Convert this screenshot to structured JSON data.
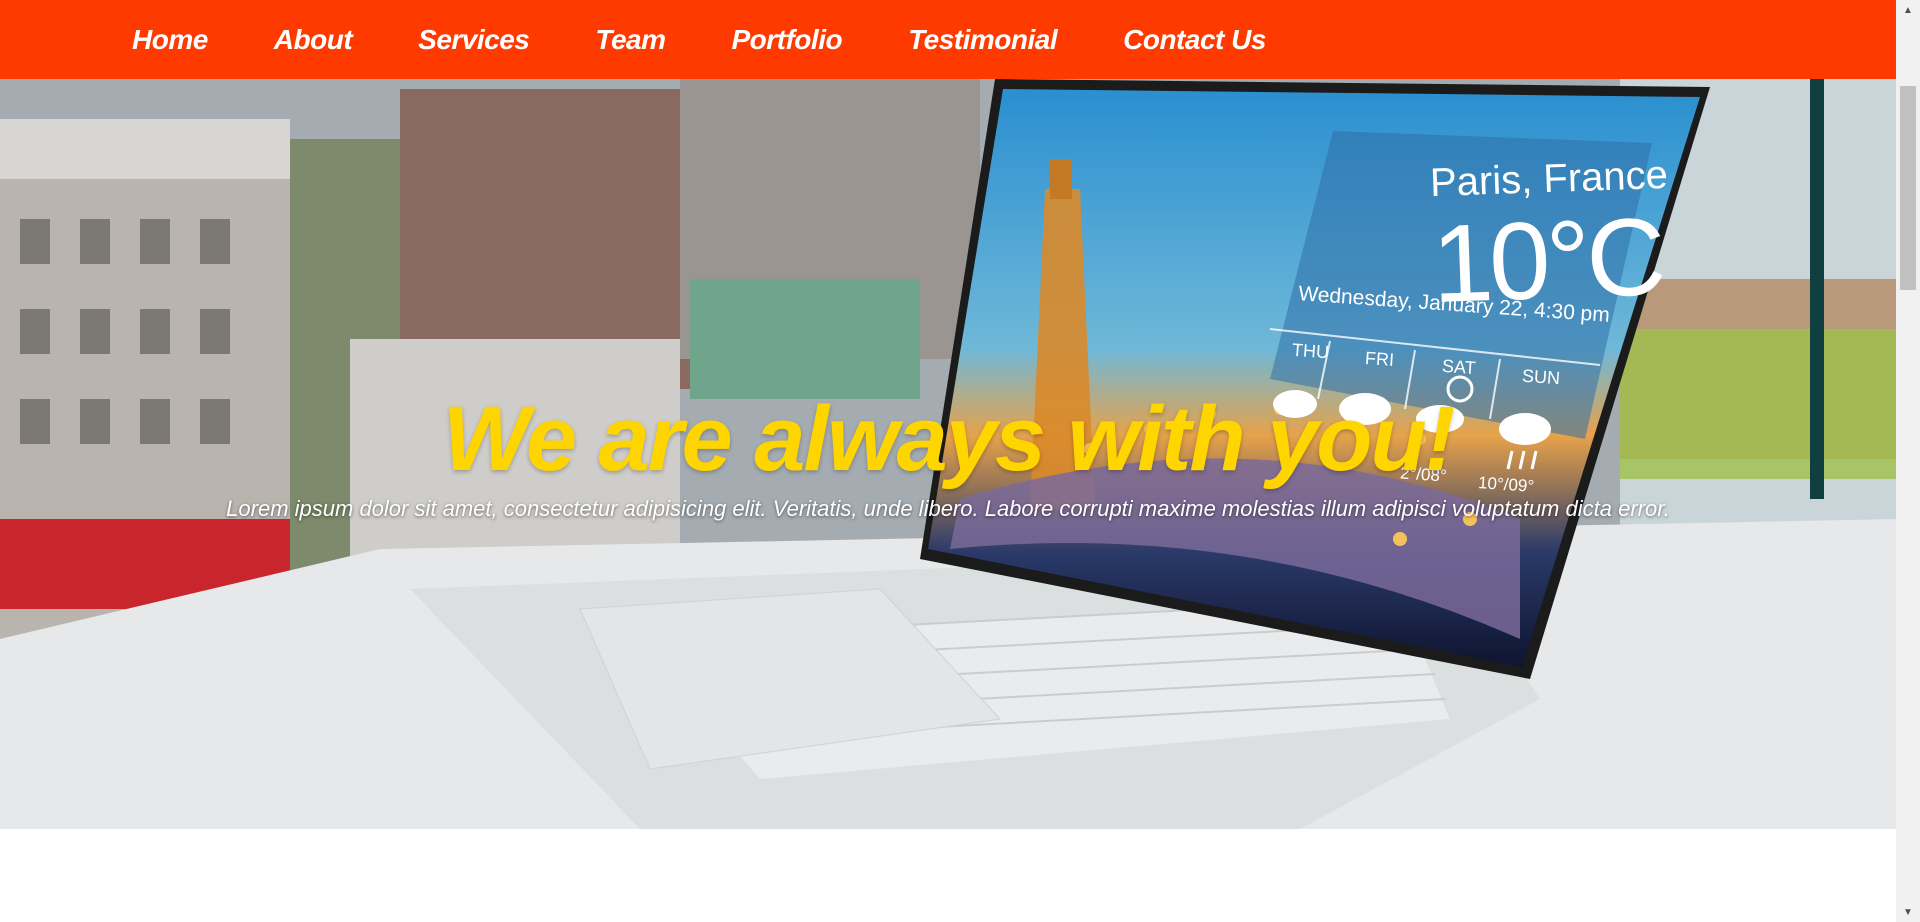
{
  "nav": {
    "items": [
      {
        "label": "Home"
      },
      {
        "label": "About"
      },
      {
        "label": "Services"
      },
      {
        "label": "Team"
      },
      {
        "label": "Portfolio"
      },
      {
        "label": "Testimonial"
      },
      {
        "label": "Contact Us"
      }
    ]
  },
  "hero": {
    "title": "We are always with you!",
    "subtitle": "Lorem ipsum dolor sit amet, consectetur adipisicing elit. Veritatis, unde libero. Labore corrupti maxime molestias illum adipisci voluptatum dicta error.",
    "weather": {
      "city": "Paris, France",
      "temp": "10°C",
      "date": "Wednesday, January 22, 4:30 pm",
      "days": [
        "THU",
        "FRI",
        "SAT",
        "SUN"
      ],
      "ranges": [
        "2°/08°",
        "10°/09°"
      ]
    }
  },
  "colors": {
    "nav_bg": "#ff3a00",
    "title": "#ffd500",
    "nav_text": "#ffffff"
  }
}
